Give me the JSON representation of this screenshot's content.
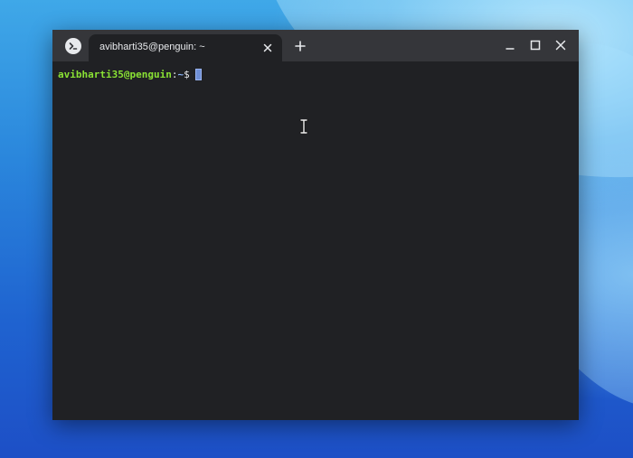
{
  "window": {
    "tab_title": "avibharti35@penguin: ~"
  },
  "terminal": {
    "prompt_user_host": "avibharti35@penguin",
    "prompt_colon": ":",
    "prompt_path": "~",
    "prompt_symbol": "$"
  },
  "icons": {
    "app": "terminal-icon",
    "tab_close": "close-icon",
    "new_tab": "plus-icon",
    "minimize": "minimize-icon",
    "maximize": "maximize-icon",
    "close": "close-icon",
    "pointer": "ibeam-cursor-icon"
  },
  "colors": {
    "titlebar": "#35363a",
    "terminal_bg": "#202124",
    "prompt_user": "#8ae234",
    "prompt_path": "#8ab4f8",
    "cursor": "#6f8fd6"
  }
}
